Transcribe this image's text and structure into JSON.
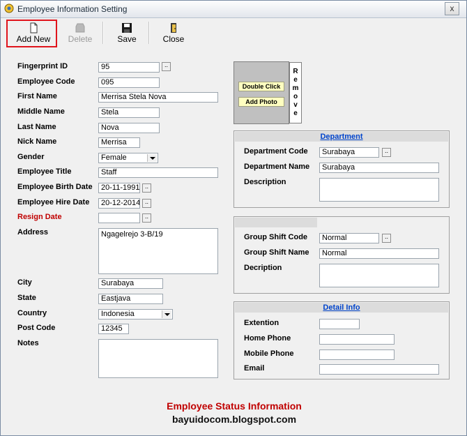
{
  "window": {
    "title": "Employee Information Setting",
    "close_glyph": "x"
  },
  "toolbar": {
    "add_new": "Add New",
    "delete": "Delete",
    "save": "Save",
    "close": "Close"
  },
  "employee": {
    "fingerprint_id": {
      "label": "Fingerprint ID",
      "value": "95"
    },
    "employee_code": {
      "label": "Employee Code",
      "value": "095"
    },
    "first_name": {
      "label": "First Name",
      "value": "Merrisa Stela Nova"
    },
    "middle_name": {
      "label": "Middle Name",
      "value": "Stela"
    },
    "last_name": {
      "label": "Last Name",
      "value": "Nova"
    },
    "nick_name": {
      "label": "Nick Name",
      "value": "Merrisa"
    },
    "gender": {
      "label": "Gender",
      "value": "Female"
    },
    "employee_title": {
      "label": "Employee Title",
      "value": "Staff"
    },
    "birth_date": {
      "label": "Employee Birth Date",
      "value": "20-11-1991"
    },
    "hire_date": {
      "label": "Employee Hire Date",
      "value": "20-12-2014"
    },
    "resign_date": {
      "label": "Resign Date",
      "value": ""
    },
    "address": {
      "label": "Address",
      "value": "Ngagelrejo 3-B/19"
    },
    "city": {
      "label": "City",
      "value": "Surabaya"
    },
    "state": {
      "label": "State",
      "value": "Eastjava"
    },
    "country": {
      "label": "Country",
      "value": "Indonesia"
    },
    "post_code": {
      "label": "Post Code",
      "value": "12345"
    },
    "notes": {
      "label": "Notes",
      "value": ""
    }
  },
  "photo": {
    "line1": "Double Click",
    "line2": "Add Photo",
    "remove_letters": [
      "R",
      "e",
      "m",
      "o",
      "v",
      "e"
    ]
  },
  "department": {
    "header": "Department",
    "code_label": "Department Code",
    "code_value": "Surabaya",
    "name_label": "Department Name",
    "name_value": "Surabaya",
    "desc_label": "Description",
    "desc_value": ""
  },
  "group_shift": {
    "header": "",
    "code_label": "Group Shift Code",
    "code_value": "Normal",
    "name_label": "Group Shift Name",
    "name_value": "Normal",
    "desc_label": "Decription",
    "desc_value": ""
  },
  "detail_info": {
    "header": "Detail Info",
    "extension_label": "Extention",
    "extension_value": "",
    "home_phone_label": "Home Phone",
    "home_phone_value": "",
    "mobile_phone_label": "Mobile Phone",
    "mobile_phone_value": "",
    "email_label": "Email",
    "email_value": ""
  },
  "footer": {
    "status_title": "Employee Status Information",
    "watermark": "bayuidocom.blogspot.com"
  },
  "colors": {
    "highlight": "#e0141c",
    "link": "#0044cc",
    "status_title": "#c00000"
  }
}
